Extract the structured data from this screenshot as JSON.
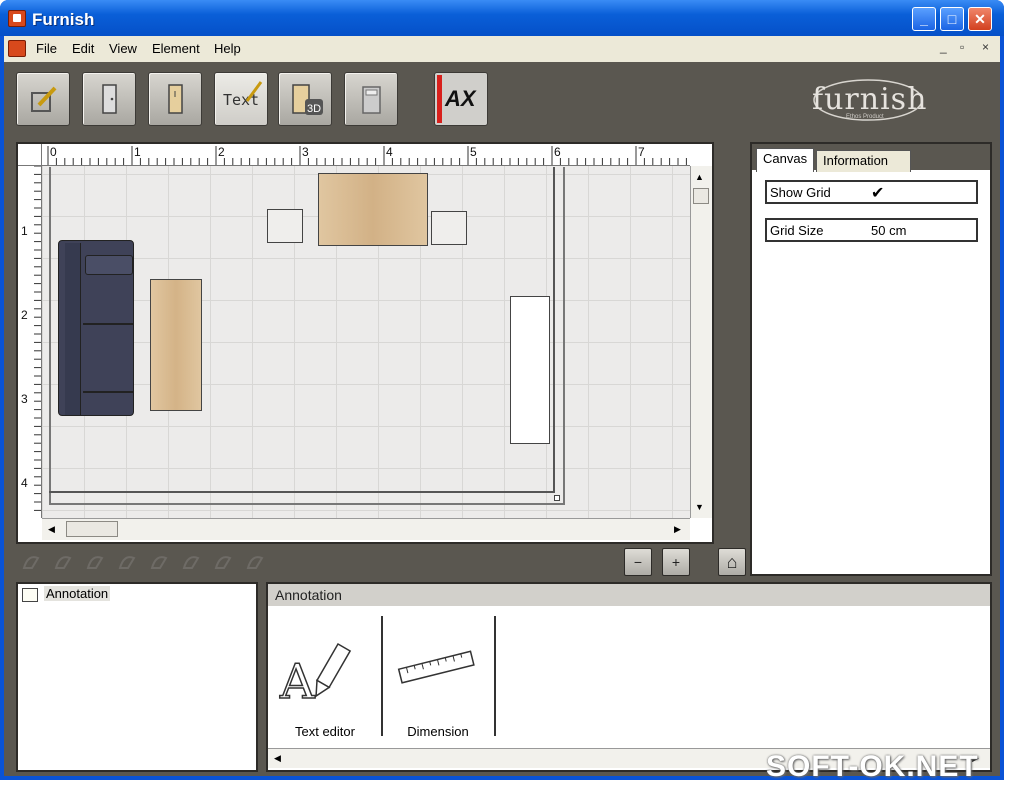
{
  "window": {
    "title": "Furnish",
    "minimize": "_",
    "maximize": "□",
    "close": "✕"
  },
  "menubar": {
    "items": [
      "File",
      "Edit",
      "View",
      "Element",
      "Help"
    ],
    "mdi_controls": [
      "_",
      "▫",
      "×"
    ]
  },
  "toolbar": {
    "buttons": [
      {
        "name": "draw-tool",
        "icon": "pencil-square-icon"
      },
      {
        "name": "door-tool",
        "icon": "door-icon"
      },
      {
        "name": "cabinet-tool",
        "icon": "cabinet-icon"
      },
      {
        "name": "text-tool",
        "label": "Text",
        "icon": "text-pencil-icon"
      },
      {
        "name": "3d-view",
        "icon": "3d-box-icon"
      },
      {
        "name": "calculator-tool",
        "icon": "calculator-icon"
      }
    ],
    "ax_label": "AX",
    "logo_text": "furnish",
    "logo_subtitle": "Ethos Product"
  },
  "canvas": {
    "ruler_x": [
      "0",
      "1",
      "2",
      "3",
      "4",
      "5",
      "6",
      "7"
    ],
    "ruler_y": [
      "1",
      "2",
      "3",
      "4"
    ],
    "furniture": [
      "sofa",
      "dining-table",
      "chair",
      "chair",
      "coffee-table",
      "cabinet"
    ]
  },
  "tool_strip": {
    "zoom_out": "−",
    "zoom_in": "+",
    "home": "⌂"
  },
  "properties": {
    "tabs": [
      "Canvas",
      "Information"
    ],
    "active_tab": "Canvas",
    "rows": [
      {
        "key": "Show Grid",
        "value": "✔"
      },
      {
        "key": "Grid Size",
        "value": "50 cm"
      }
    ]
  },
  "tree": {
    "items": [
      "Annotation"
    ]
  },
  "palette": {
    "header": "Annotation",
    "items": [
      {
        "label": "Text editor",
        "icon": "text-editor-icon"
      },
      {
        "label": "Dimension",
        "icon": "dimension-ruler-icon"
      }
    ]
  },
  "watermark": "SOFT-OK.NET"
}
